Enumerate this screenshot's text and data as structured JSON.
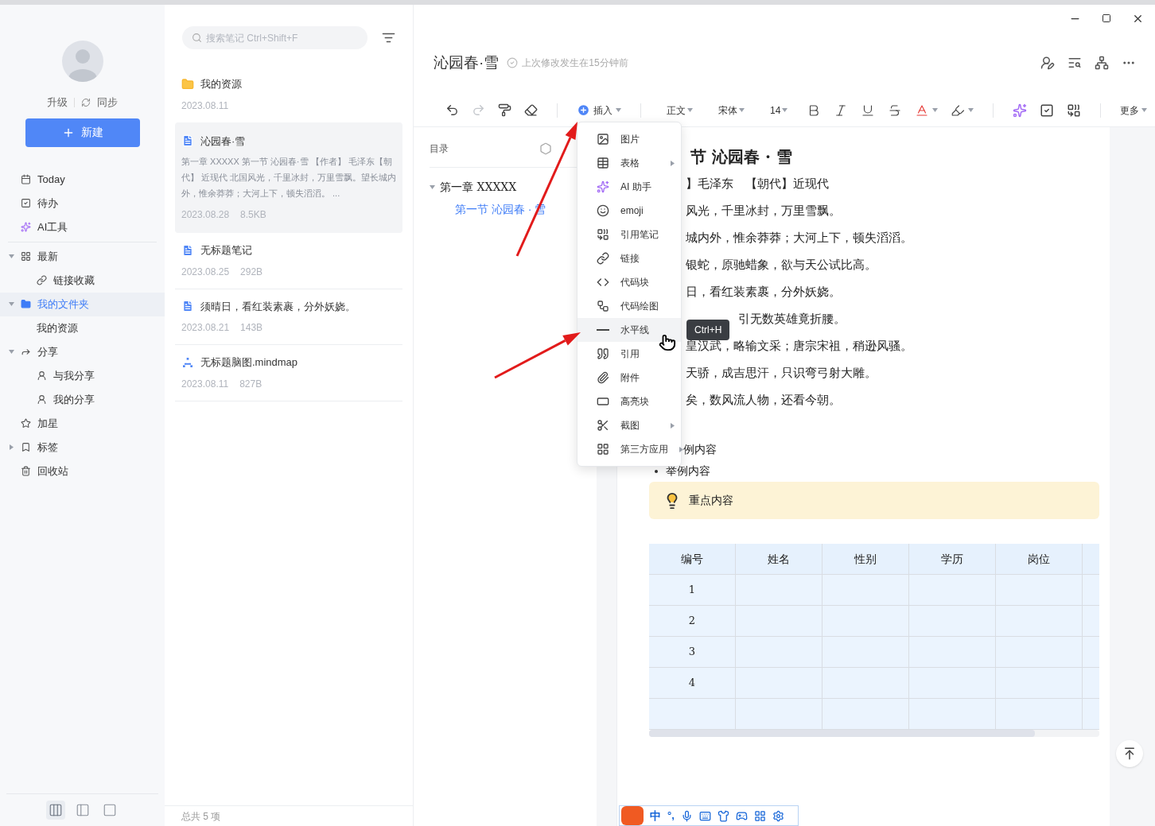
{
  "sidebar": {
    "account": {
      "upgrade": "升级",
      "sync": "同步"
    },
    "new_button": "新建",
    "nav": [
      {
        "kind": "today",
        "label": "Today",
        "selected": false
      },
      {
        "kind": "todo",
        "label": "待办",
        "selected": false
      },
      {
        "kind": "ai",
        "label": "AI工具",
        "selected": false
      },
      {
        "kind": "divider"
      },
      {
        "kind": "recent",
        "label": "最新",
        "selected": false,
        "expanded": true,
        "children": [
          {
            "kind": "link",
            "label": "链接收藏",
            "selected": false
          }
        ]
      },
      {
        "kind": "folder",
        "label": "我的文件夹",
        "selected": true,
        "expanded": true,
        "children": [
          {
            "kind": "none",
            "label": "我的资源",
            "selected": false
          }
        ]
      },
      {
        "kind": "share",
        "label": "分享",
        "selected": false,
        "expanded": true,
        "children": [
          {
            "kind": "user",
            "label": "与我分享",
            "selected": false
          },
          {
            "kind": "user",
            "label": "我的分享",
            "selected": false
          }
        ]
      },
      {
        "kind": "star",
        "label": "加星",
        "selected": false
      },
      {
        "kind": "tag",
        "label": "标签",
        "selected": false,
        "expanded": false
      },
      {
        "kind": "trash",
        "label": "回收站",
        "selected": false
      }
    ],
    "layouts": [
      {
        "kind": "three",
        "selected": true
      },
      {
        "kind": "two",
        "selected": false
      },
      {
        "kind": "one",
        "selected": false
      }
    ]
  },
  "note_list": {
    "search": {
      "placeholder": "搜索笔记 Ctrl+Shift+F"
    },
    "notes": [
      {
        "kind": "folder",
        "title": "我的资源",
        "date": "2023.08.11",
        "selected": false
      },
      {
        "kind": "doc",
        "title": "沁园春·雪",
        "excerpt": "第一章 XXXXX 第一节 沁园春·雪 【作者】 毛泽东【朝代】 近现代 北国风光，千里冰封，万里雪飘。望长城内外，惟余莽莽；大河上下，顿失滔滔。 ...",
        "date": "2023.08.28",
        "size": "8.5KB",
        "selected": true
      },
      {
        "kind": "doc",
        "title": "无标题笔记",
        "date": "2023.08.25",
        "size": "292B",
        "selected": false
      },
      {
        "kind": "doc",
        "title": "须晴日，看红装素裹，分外妖娆。",
        "date": "2023.08.21",
        "size": "143B",
        "selected": false
      },
      {
        "kind": "mindmap",
        "title": "无标题脑图.mindmap",
        "date": "2023.08.11",
        "size": "827B",
        "selected": false
      }
    ],
    "footer": "总共 5 项"
  },
  "editor": {
    "title": "沁园春·雪",
    "status": "上次修改发生在15分钟前",
    "toolbar": {
      "history": [
        {
          "kind": "undo",
          "disabled": false
        },
        {
          "kind": "redo",
          "disabled": true
        }
      ],
      "tools": [
        {
          "kind": "format-painter"
        },
        {
          "kind": "eraser"
        }
      ],
      "insert_button": "插入",
      "dropdowns": [
        "正文",
        "宋体",
        "14"
      ],
      "format": [
        {
          "kind": "bold"
        },
        {
          "kind": "italic"
        },
        {
          "kind": "underline"
        },
        {
          "kind": "strikethrough"
        },
        {
          "kind": "font-color"
        },
        {
          "kind": "highlight"
        }
      ],
      "extras": [
        {
          "kind": "ai"
        },
        {
          "kind": "task"
        },
        {
          "kind": "note-link"
        }
      ],
      "more_button": "更多"
    },
    "toc": {
      "title": "目录",
      "items": [
        {
          "label": "第一章  XXXXX",
          "expanded": true,
          "selected": false,
          "children": [
            {
              "label": "第一节  沁园春 · 雪",
              "selected": true
            }
          ]
        }
      ]
    },
    "document": {
      "heading": "节  沁园春 · 雪",
      "lines": [
        {
          "kind": "text",
          "text": "】毛泽东　【朝代】近现代"
        },
        {
          "kind": "text",
          "text": "风光，千里冰封，万里雪飘。"
        },
        {
          "kind": "text",
          "text": "城内外，惟余莽莽；大河上下，顿失滔滔。"
        },
        {
          "kind": "text",
          "text": "银蛇，原驰蜡象，欲与天公试比高。"
        },
        {
          "kind": "text",
          "text": "日，看红装素裹，分外妖娆。"
        },
        {
          "kind": "covered",
          "text": "引无数英雄竟折腰。"
        },
        {
          "kind": "text",
          "text": "皇汉武，略输文采；唐宗宋祖，稍逊风骚。"
        },
        {
          "kind": "text",
          "text": "天骄，成吉思汗，只识弯弓射大雕。"
        },
        {
          "kind": "text",
          "text": "矣，数风流人物，还看今朝。"
        }
      ],
      "bullets": [
        {
          "text": "例内容",
          "covered": true
        },
        {
          "text": "举例内容",
          "covered": false
        }
      ],
      "callout": "重点内容",
      "table": {
        "columns": [
          "编号",
          "姓名",
          "性别",
          "学历",
          "岗位"
        ],
        "rows": [
          [
            "1"
          ],
          [
            "2"
          ],
          [
            "3"
          ],
          [
            "4"
          ]
        ],
        "trailing_blank_row": true
      }
    },
    "insert_menu": [
      {
        "kind": "image",
        "label": "图片",
        "submenu": false,
        "selected": false
      },
      {
        "kind": "table",
        "label": "表格",
        "submenu": true,
        "selected": false
      },
      {
        "kind": "ai",
        "label": "AI 助手",
        "submenu": false,
        "selected": false
      },
      {
        "kind": "emoji",
        "label": "emoji",
        "submenu": false,
        "selected": false
      },
      {
        "kind": "note-ref",
        "label": "引用笔记",
        "submenu": false,
        "selected": false
      },
      {
        "kind": "link",
        "label": "链接",
        "submenu": false,
        "selected": false
      },
      {
        "kind": "code",
        "label": "代码块",
        "submenu": false,
        "selected": false
      },
      {
        "kind": "diagram",
        "label": "代码绘图",
        "submenu": false,
        "selected": false
      },
      {
        "kind": "hr",
        "label": "水平线",
        "submenu": false,
        "selected": true,
        "tooltip": "Ctrl+H"
      },
      {
        "kind": "quote",
        "label": "引用",
        "submenu": false,
        "selected": false
      },
      {
        "kind": "attachment",
        "label": "附件",
        "submenu": false,
        "selected": false
      },
      {
        "kind": "highlight-block",
        "label": "高亮块",
        "submenu": false,
        "selected": false
      },
      {
        "kind": "screenshot",
        "label": "截图",
        "submenu": true,
        "selected": false
      },
      {
        "kind": "apps",
        "label": "第三方应用",
        "submenu": true,
        "selected": false
      }
    ]
  },
  "ime_bar": {
    "mode": "中",
    "punctuation": "°,"
  }
}
